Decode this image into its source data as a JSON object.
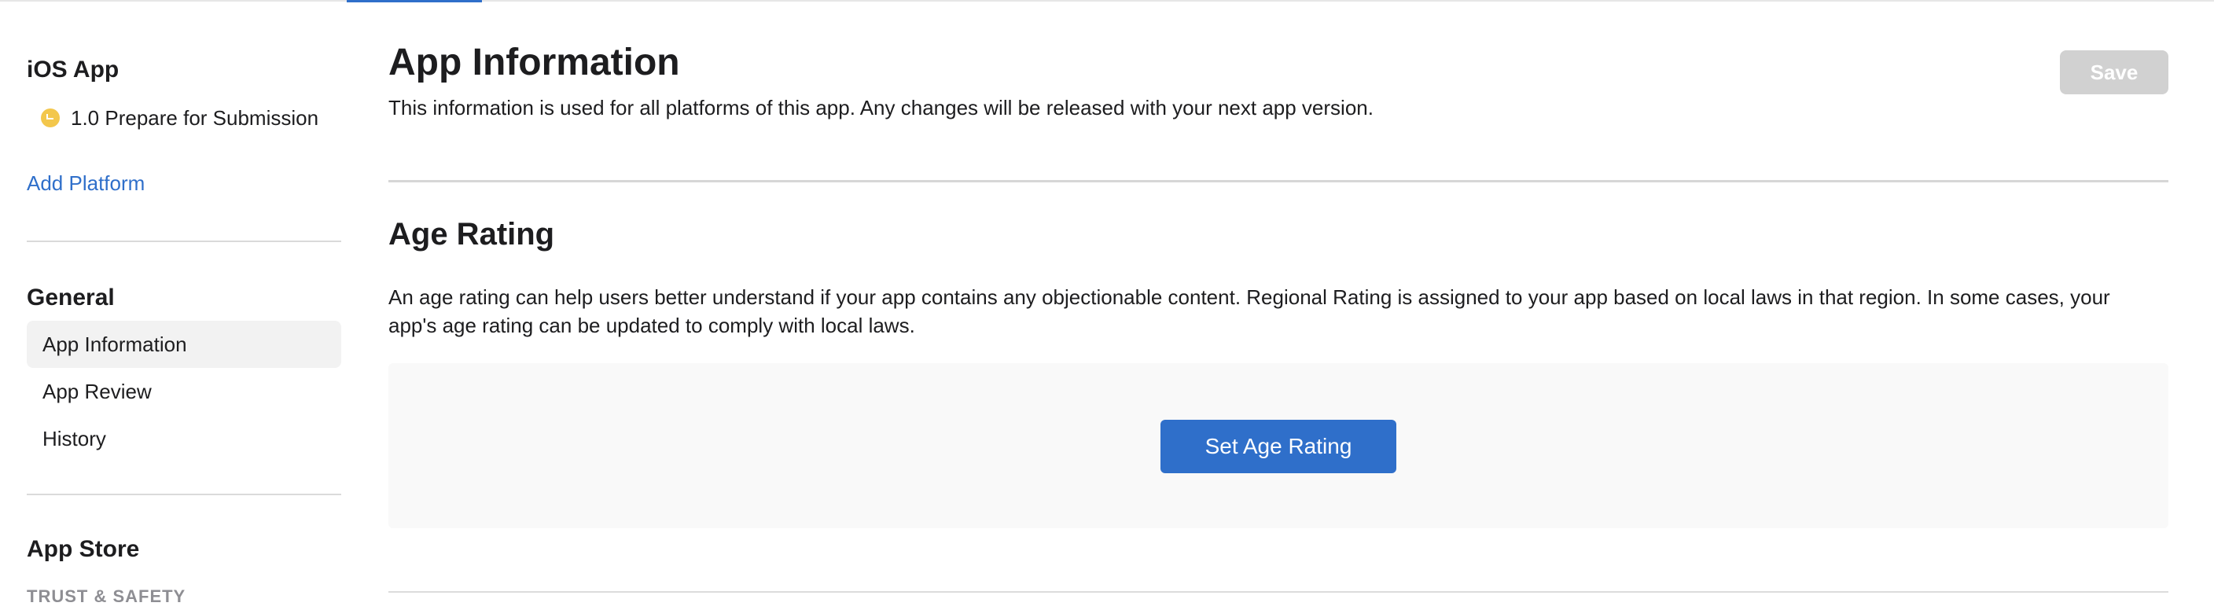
{
  "sidebar": {
    "ios_app_title": "iOS App",
    "version_item": {
      "label": "1.0 Prepare for Submission",
      "status_icon": "clock-yellow-icon",
      "status_color": "#f3c74c"
    },
    "add_platform_label": "Add Platform",
    "general_title": "General",
    "general_items": [
      {
        "label": "App Information",
        "active": true
      },
      {
        "label": "App Review",
        "active": false
      },
      {
        "label": "History",
        "active": false
      }
    ],
    "app_store_title": "App Store",
    "trust_safety_label": "TRUST & SAFETY"
  },
  "main": {
    "title": "App Information",
    "subtitle": "This information is used for all platforms of this app. Any changes will be released with your next app version.",
    "save_label": "Save",
    "age_rating": {
      "heading": "Age Rating",
      "description": "An age rating can help users better understand if your app contains any objectionable content. Regional Rating is assigned to your app based on local laws in that region. In some cases, your app's age rating can be updated to comply with local laws.",
      "button_label": "Set Age Rating"
    }
  },
  "colors": {
    "accent": "#2f6fca",
    "save_disabled": "#d1d1d1",
    "active_nav_bg": "#f2f2f2",
    "status_yellow": "#f3c74c"
  }
}
